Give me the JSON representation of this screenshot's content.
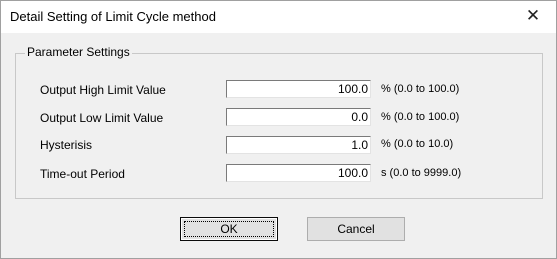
{
  "window": {
    "title": "Detail Setting of Limit Cycle method",
    "close_glyph": "✕"
  },
  "group": {
    "title": "Parameter Settings"
  },
  "params": [
    {
      "label": "Output High Limit Value",
      "value": "100.0",
      "range": "% (0.0 to 100.0)"
    },
    {
      "label": "Output Low Limit Value",
      "value": "0.0",
      "range": "% (0.0 to 100.0)"
    },
    {
      "label": "Hysterisis",
      "value": "1.0",
      "range": "% (0.0 to 10.0)"
    },
    {
      "label": "Time-out Period",
      "value": "100.0",
      "range": "s (0.0 to 9999.0)"
    }
  ],
  "buttons": {
    "ok": "OK",
    "cancel": "Cancel"
  }
}
